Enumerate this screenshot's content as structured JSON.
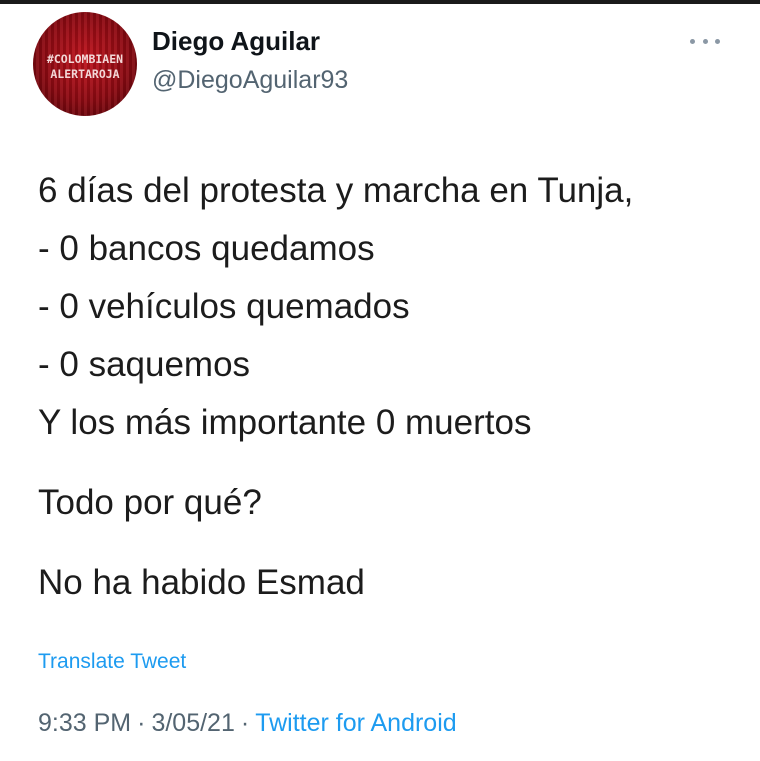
{
  "author": {
    "display_name": "Diego Aguilar",
    "handle": "@DiegoAguilar93",
    "avatar_text": [
      "#COLOMBIAEN",
      "ALERTAROJA"
    ]
  },
  "more_icon": "more-horizontal-icon",
  "tweet": {
    "paragraphs": [
      {
        "lines": [
          "6 días del protesta y marcha en Tunja,",
          "- 0 bancos quedamos",
          "- 0 vehículos quemados",
          "- 0 saquemos",
          "Y los más importante 0 muertos"
        ]
      },
      {
        "lines": [
          "Todo por qué?"
        ]
      },
      {
        "lines": [
          "No ha habido Esmad"
        ]
      }
    ]
  },
  "translate_label": "Translate Tweet",
  "meta": {
    "time": "9:33 PM",
    "date": "3/05/21",
    "separator": "·",
    "source": "Twitter for Android"
  },
  "colors": {
    "text": "#0f1419",
    "secondary": "#536471",
    "link": "#1d9bf0",
    "avatar_red": "#c0121c"
  }
}
